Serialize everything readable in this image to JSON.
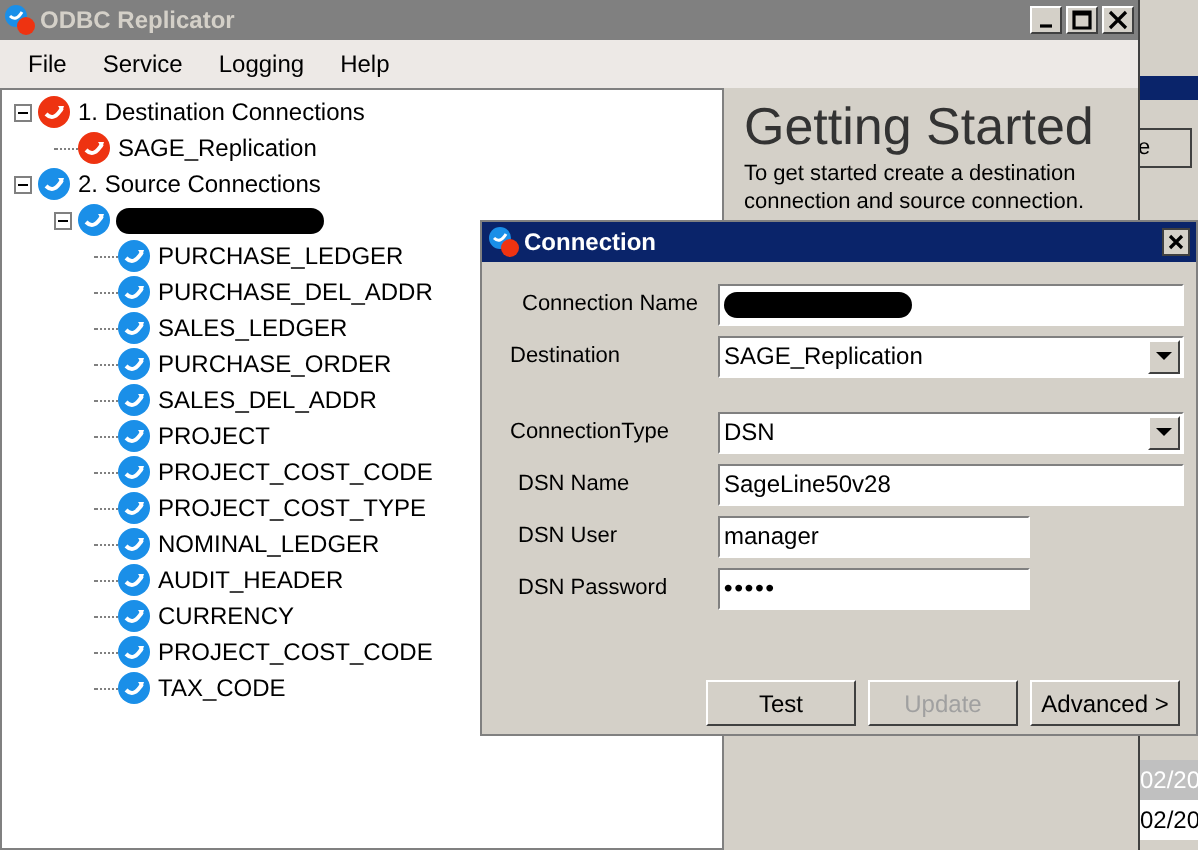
{
  "window": {
    "title": "ODBC Replicator"
  },
  "menu": [
    "File",
    "Service",
    "Logging",
    "Help"
  ],
  "tree": [
    {
      "label": "1. Destination Connections",
      "kind": "destination",
      "expanded": true,
      "children": [
        {
          "label": "SAGE_Replication",
          "kind": "destination"
        }
      ]
    },
    {
      "label": "2. Source Connections",
      "kind": "source",
      "expanded": true,
      "children": [
        {
          "kind": "source",
          "redacted": true,
          "expanded": true,
          "children": [
            {
              "label": "PURCHASE_LEDGER",
              "kind": "source"
            },
            {
              "label": "PURCHASE_DEL_ADDR",
              "kind": "source"
            },
            {
              "label": "SALES_LEDGER",
              "kind": "source"
            },
            {
              "label": "PURCHASE_ORDER",
              "kind": "source"
            },
            {
              "label": "SALES_DEL_ADDR",
              "kind": "source"
            },
            {
              "label": "PROJECT",
              "kind": "source"
            },
            {
              "label": "PROJECT_COST_CODE",
              "kind": "source"
            },
            {
              "label": "PROJECT_COST_TYPE",
              "kind": "source"
            },
            {
              "label": "NOMINAL_LEDGER",
              "kind": "source"
            },
            {
              "label": "AUDIT_HEADER",
              "kind": "source"
            },
            {
              "label": "CURRENCY",
              "kind": "source"
            },
            {
              "label": "PROJECT_COST_CODE",
              "kind": "source"
            },
            {
              "label": "TAX_CODE",
              "kind": "source"
            }
          ]
        }
      ]
    }
  ],
  "getting_started": {
    "heading": "Getting Started",
    "text": "To get started create a destination connection and source connection."
  },
  "background_window": {
    "button_text": "e",
    "rows": [
      {
        "text": "02/20",
        "selected": true
      },
      {
        "text": "02/20",
        "selected": false
      }
    ]
  },
  "dialog": {
    "title": "Connection",
    "fields": [
      {
        "label": "Connection Name",
        "kind": "text",
        "redacted": true
      },
      {
        "label": "Destination",
        "kind": "dropdown",
        "value": "SAGE_Replication"
      },
      {
        "label": "ConnectionType",
        "kind": "dropdown",
        "value": "DSN"
      },
      {
        "label": "DSN Name",
        "kind": "text",
        "value": "SageLine50v28"
      },
      {
        "label": "DSN User",
        "kind": "short",
        "value": "manager"
      },
      {
        "label": "DSN Password",
        "kind": "password",
        "value": "•••••"
      }
    ],
    "buttons": [
      {
        "label": "Test",
        "disabled": false
      },
      {
        "label": "Update",
        "disabled": true
      },
      {
        "label": "Advanced >",
        "disabled": false
      }
    ]
  }
}
